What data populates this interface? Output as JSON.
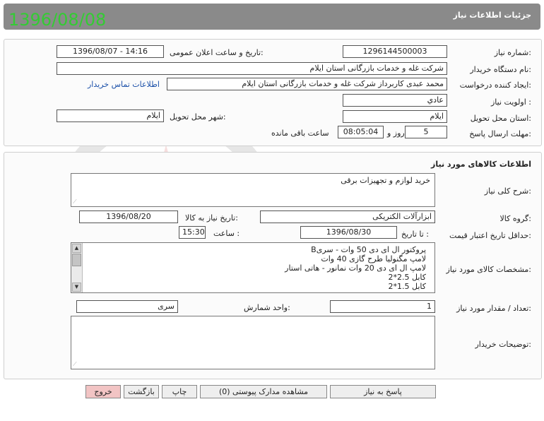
{
  "header": {
    "title": "جزئیات اطلاعات نیاز",
    "date_stamp": "1396/08/08"
  },
  "need_info": {
    "need_number_label": "شماره نیاز:",
    "need_number": "1296144500003",
    "announce_label": "تاریخ و ساعت اعلان عمومی:",
    "announce_value": "1396/08/07 - 14:16",
    "buyer_org_label": "نام دستگاه خریدار:",
    "buyer_org": "شرکت غله و خدمات بازرگانی استان ایلام",
    "requester_label": "ایجاد کننده درخواست:",
    "requester": "محمد عبدی کاربرداز شرکت غله و خدمات بازرگانی استان ایلام",
    "contact_link": "اطلاعات تماس خریدار",
    "priority_label": "اولویت نیاز :",
    "priority": "عادي",
    "province_label": "استان محل تحویل:",
    "province": "ایلام",
    "city_label": "شهر محل تحویل:",
    "city": "ایلام",
    "deadline_label": "مهلت ارسال پاسخ:",
    "deadline_days": "5",
    "days_word": "روز و",
    "deadline_time": "08:05:04",
    "remaining_word": "ساعت باقی مانده"
  },
  "goods": {
    "section_title": "اطلاعات کالاهای مورد نیاز",
    "general_desc_label": "شرح کلی نیاز:",
    "general_desc": "خرید لوازم و تجهیزات برقی",
    "goods_group_label": "گروه کالا:",
    "goods_group": "ابزارآلات الکتریکی",
    "need_date_label": "تاریخ نیاز به کالا:",
    "need_date": "1396/08/20",
    "min_validity_label": "حداقل تاریخ اعتبار قیمت:",
    "until_date_label": "تا تاریخ :",
    "until_date": "1396/08/30",
    "time_label": "ساعت :",
    "time_value": "15:30",
    "specs_label": "مشخصات کالای مورد نیاز:",
    "specs_lines": [
      "پروکتور ال ای دی 50 وات - سریB",
      "لامپ مگنولیا طرح گازی 40 وات",
      "لامپ ال ای دی 20 وات نمانور - هاتی استار",
      "کابل 2.5*2",
      "کابل 1.5*2"
    ],
    "qty_label": "تعداد / مقدار مورد نیاز:",
    "qty": "1",
    "unit_label": "واحد شمارش:",
    "unit": "سری",
    "buyer_notes_label": "توضیحات خریدار:",
    "buyer_notes": ""
  },
  "actions": {
    "reply": "پاسخ به نیاز",
    "view_docs": "مشاهده مدارک پیوستی (0)",
    "print": "چاپ",
    "back": "بازگشت",
    "exit": "خروج"
  },
  "watermark_text": "هزاره گستران ارتباط",
  "colors": {
    "header_bg": "#8a8a8a",
    "date_stamp": "#33cc33",
    "link": "#1a4fa8",
    "exit_button": "#f2c4c4"
  }
}
